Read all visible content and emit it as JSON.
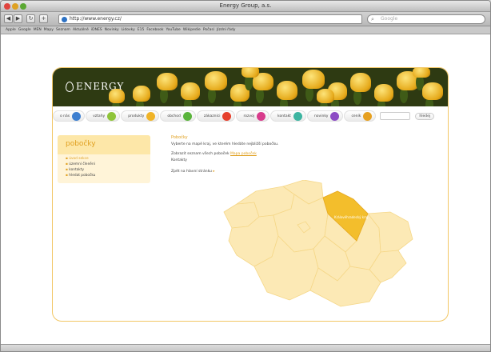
{
  "browser": {
    "title": "Energy Group, a.s.",
    "url": "http://www.energy.cz/",
    "search_placeholder": "Google",
    "bookmarks": [
      "Apple",
      "Google",
      "MEN",
      "Mapy",
      "Seznam",
      "Aktuálně",
      "iDNES",
      "Novinky",
      "Lidovky",
      "E15",
      "Facebook",
      "YouTube",
      "Wikipedie",
      "Počasí",
      "Jízdní řády"
    ]
  },
  "site": {
    "logo_text": "ENERGY",
    "nav": [
      {
        "label": "o nás",
        "color": "#3d7fd0"
      },
      {
        "label": "vztahy",
        "color": "#8fc43a"
      },
      {
        "label": "produkty",
        "color": "#f0b428"
      },
      {
        "label": "obchod",
        "color": "#5ab43c"
      },
      {
        "label": "zákazníci",
        "color": "#e6402c"
      },
      {
        "label": "rozvoj",
        "color": "#d83c8c"
      },
      {
        "label": "kontakt",
        "color": "#3cb4a0"
      },
      {
        "label": "novinky",
        "color": "#8c4cc4"
      },
      {
        "label": "ceník",
        "color": "#e6a020"
      }
    ],
    "search_button": "hledej",
    "sidebar": {
      "heading": "pobočky",
      "items": [
        "úvod sekce",
        "územní členění",
        "kontakty",
        "hledat pobočku"
      ],
      "active_index": 0
    },
    "main": {
      "title": "Pobočky",
      "intro": "Vyberte na mapě kraj, ve kterém hledáte nejbližší pobočku.",
      "line1": "Zobrazit seznam všech poboček",
      "link1": "Mapa poboček",
      "line2": "Kontakty",
      "footer_text": "Zpět na hlavní stránku"
    },
    "map": {
      "highlighted_region_label": "Královéhradecký kraj",
      "regions": [
        "Karlovarský",
        "Ústecký",
        "Liberecký",
        "Královéhradecký",
        "Pardubický",
        "Středočeský",
        "Praha",
        "Plzeňský",
        "Jihočeský",
        "Vysočina",
        "Jihomoravský",
        "Olomoucký",
        "Moravskoslezský",
        "Zlínský"
      ],
      "highlight_color": "#f3be2c",
      "base_color": "#fce9b5"
    }
  }
}
